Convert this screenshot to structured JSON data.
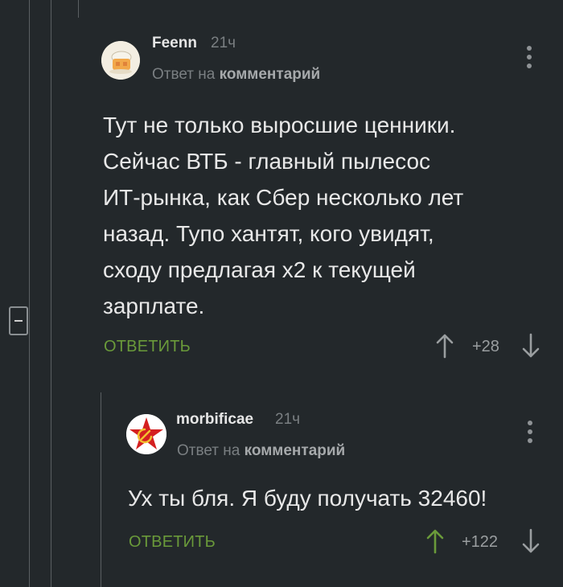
{
  "comments": [
    {
      "author": "Feenn",
      "time": "21ч",
      "reply_prefix": "Ответ на",
      "reply_target": "комментарий",
      "body_lines": [
        "Тут не только выросшие ценники.",
        "Сейчас ВТБ - главный пылесос",
        "ИТ-рынка, как Сбер несколько лет",
        "назад. Тупо хантят, кого увидят,",
        "сходу предлагая х2 к текущей",
        "зарплате."
      ],
      "reply_label": "ОТВЕТИТЬ",
      "rating": "+28",
      "upvoted": false
    },
    {
      "author": "morbificae",
      "time": "21ч",
      "reply_prefix": "Ответ на",
      "reply_target": "комментарий",
      "body_lines": [
        "Ух ты бля. Я буду получать 32460!"
      ],
      "reply_label": "ОТВЕТИТЬ",
      "rating": "+122",
      "upvoted": true
    }
  ],
  "icons": {
    "upvote": "arrow-up-icon",
    "downvote": "arrow-down-icon",
    "more": "more-vertical-icon",
    "collapse": "minus-icon"
  },
  "colors": {
    "background": "#23282b",
    "accent_green": "#6a9a3a",
    "text": "#e8e8e8",
    "muted": "#7a7f82"
  }
}
